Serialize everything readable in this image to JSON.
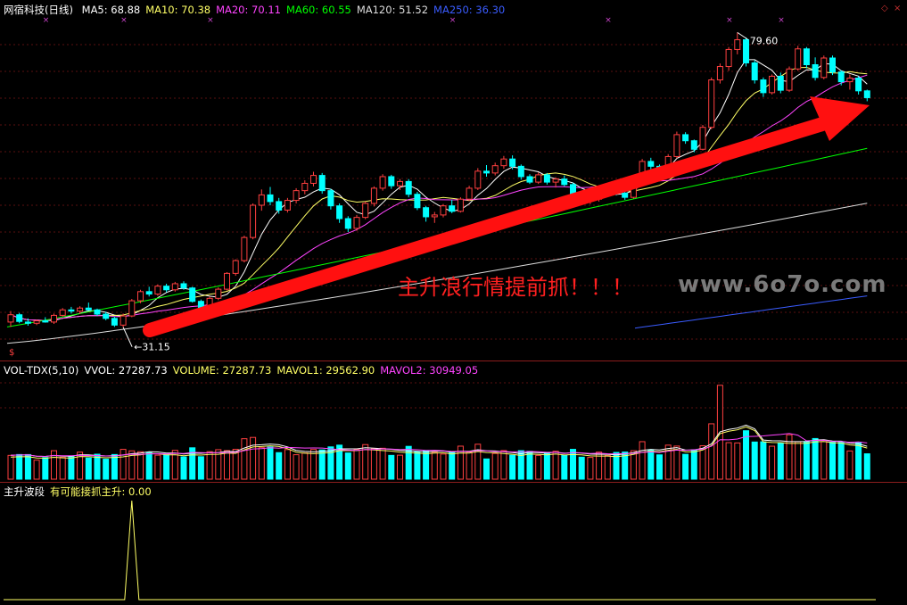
{
  "price_panel": {
    "title": "网宿科技(日线)",
    "ma_labels": [
      {
        "key": "MA5",
        "label": "MA5: 68.88",
        "color": "#ffffff"
      },
      {
        "key": "MA10",
        "label": "MA10: 70.38",
        "color": "#ffff66"
      },
      {
        "key": "MA20",
        "label": "MA20: 70.11",
        "color": "#ff44ff"
      },
      {
        "key": "MA60",
        "label": "MA60: 60.55",
        "color": "#00ff00"
      },
      {
        "key": "MA120",
        "label": "MA120: 51.52",
        "color": "#dddddd"
      },
      {
        "key": "MA250",
        "label": "MA250: 36.30",
        "color": "#3a5cff"
      }
    ],
    "high_label": "79.60",
    "low_label": "31.15",
    "annotation": "主升浪行情提前抓！！！",
    "watermark": "www.6o7o.com",
    "dollar_mark": "$"
  },
  "volume_panel": {
    "labels": [
      {
        "text": "VOL-TDX(5,10)",
        "color": "#ffffff"
      },
      {
        "text": "VVOL: 27287.73",
        "color": "#ffffff"
      },
      {
        "text": "VOLUME: 27287.73",
        "color": "#ffff66"
      },
      {
        "text": "MAVOL1: 29562.90",
        "color": "#ffff66"
      },
      {
        "text": "MAVOL2: 30949.05",
        "color": "#ff44ff"
      }
    ]
  },
  "indicator_panel": {
    "labels": [
      {
        "text": "主升波段",
        "color": "#ffffff"
      },
      {
        "text": "有可能接抓主升: 0.00",
        "color": "#ffff66"
      }
    ]
  },
  "colors": {
    "up": "#ff4040",
    "down": "#00ffff",
    "arrow": "#ff1010",
    "separator": "#8c1d1d"
  },
  "chart_data": {
    "type": "bar",
    "title": "网宿科技(日线)",
    "candles": [
      [
        32.0,
        33.8,
        31.2,
        33.2
      ],
      [
        33.2,
        33.5,
        31.8,
        32.1
      ],
      [
        32.0,
        32.6,
        31.4,
        31.8
      ],
      [
        31.8,
        32.4,
        31.5,
        32.2
      ],
      [
        32.2,
        32.8,
        31.9,
        32.0
      ],
      [
        32.0,
        33.4,
        31.7,
        33.1
      ],
      [
        33.1,
        34.3,
        32.9,
        34.0
      ],
      [
        34.0,
        34.5,
        33.4,
        33.8
      ],
      [
        33.8,
        34.6,
        33.3,
        34.3
      ],
      [
        34.3,
        35.2,
        33.9,
        34.0
      ],
      [
        34.0,
        34.2,
        33.0,
        33.3
      ],
      [
        33.3,
        33.7,
        32.3,
        32.6
      ],
      [
        32.6,
        32.9,
        31.2,
        31.5
      ],
      [
        31.5,
        33.4,
        31.15,
        33.0
      ],
      [
        33.0,
        35.8,
        32.8,
        35.5
      ],
      [
        35.5,
        37.3,
        35.1,
        37.0
      ],
      [
        37.0,
        37.8,
        36.2,
        36.6
      ],
      [
        36.6,
        38.2,
        36.3,
        37.9
      ],
      [
        37.9,
        38.3,
        36.9,
        37.3
      ],
      [
        37.3,
        38.6,
        37.0,
        38.3
      ],
      [
        38.3,
        38.7,
        37.3,
        37.6
      ],
      [
        37.6,
        37.8,
        35.2,
        35.4
      ],
      [
        35.4,
        35.7,
        33.8,
        34.1
      ],
      [
        34.1,
        36.2,
        33.9,
        35.9
      ],
      [
        35.9,
        37.7,
        35.6,
        37.4
      ],
      [
        37.4,
        40.2,
        37.2,
        40.0
      ],
      [
        40.0,
        42.3,
        39.6,
        42.1
      ],
      [
        42.1,
        46.2,
        41.8,
        45.9
      ],
      [
        45.9,
        51.5,
        45.6,
        51.2
      ],
      [
        51.2,
        53.8,
        50.3,
        52.9
      ],
      [
        52.9,
        54.2,
        51.2,
        51.8
      ],
      [
        51.8,
        52.4,
        49.8,
        50.4
      ],
      [
        50.4,
        52.4,
        50.0,
        52.0
      ],
      [
        52.0,
        54.0,
        51.5,
        53.6
      ],
      [
        53.6,
        55.3,
        53.0,
        54.8
      ],
      [
        54.8,
        56.7,
        54.3,
        56.1
      ],
      [
        56.1,
        56.5,
        53.1,
        53.6
      ],
      [
        53.6,
        53.9,
        50.5,
        51.1
      ],
      [
        51.1,
        51.5,
        48.3,
        49.0
      ],
      [
        49.0,
        49.4,
        46.8,
        47.4
      ],
      [
        47.4,
        49.6,
        47.0,
        49.2
      ],
      [
        49.2,
        51.8,
        48.9,
        51.5
      ],
      [
        51.5,
        54.3,
        51.0,
        54.0
      ],
      [
        54.0,
        56.3,
        53.6,
        55.9
      ],
      [
        55.9,
        56.2,
        53.9,
        54.4
      ],
      [
        54.4,
        55.5,
        53.7,
        55.1
      ],
      [
        55.1,
        55.5,
        52.5,
        53.0
      ],
      [
        53.0,
        53.4,
        50.4,
        50.8
      ],
      [
        50.8,
        51.1,
        48.5,
        49.3
      ],
      [
        49.3,
        50.1,
        48.3,
        49.6
      ],
      [
        49.6,
        51.4,
        49.2,
        51.1
      ],
      [
        51.1,
        52.1,
        49.9,
        50.2
      ],
      [
        50.2,
        52.5,
        50.0,
        52.2
      ],
      [
        52.2,
        54.4,
        51.9,
        54.0
      ],
      [
        54.0,
        57.3,
        53.7,
        56.8
      ],
      [
        56.8,
        57.8,
        55.9,
        56.5
      ],
      [
        56.5,
        58.2,
        56.1,
        57.7
      ],
      [
        57.7,
        59.3,
        57.2,
        58.8
      ],
      [
        58.8,
        59.4,
        57.1,
        57.6
      ],
      [
        57.6,
        57.9,
        55.4,
        55.9
      ],
      [
        55.9,
        56.3,
        54.7,
        55.0
      ],
      [
        55.0,
        56.6,
        54.7,
        56.2
      ],
      [
        56.2,
        56.5,
        54.6,
        55.0
      ],
      [
        55.0,
        55.8,
        54.1,
        55.5
      ],
      [
        55.5,
        56.1,
        54.3,
        54.6
      ],
      [
        54.6,
        54.9,
        52.4,
        53.0
      ],
      [
        53.0,
        53.4,
        51.5,
        51.9
      ],
      [
        51.9,
        52.6,
        51.4,
        52.2
      ],
      [
        52.2,
        53.4,
        51.8,
        53.1
      ],
      [
        53.1,
        54.8,
        52.8,
        54.5
      ],
      [
        54.5,
        54.9,
        52.8,
        53.2
      ],
      [
        53.2,
        53.6,
        52.1,
        52.5
      ],
      [
        52.5,
        55.2,
        52.3,
        54.8
      ],
      [
        54.8,
        58.8,
        54.5,
        58.4
      ],
      [
        58.4,
        59.0,
        57.1,
        57.6
      ],
      [
        57.6,
        57.9,
        56.0,
        56.5
      ],
      [
        56.5,
        59.6,
        56.3,
        59.2
      ],
      [
        59.2,
        63.3,
        58.9,
        62.8
      ],
      [
        62.8,
        63.2,
        61.3,
        61.8
      ],
      [
        61.8,
        62.0,
        59.9,
        60.4
      ],
      [
        60.4,
        64.4,
        60.2,
        64.0
      ],
      [
        64.0,
        72.2,
        63.7,
        71.8
      ],
      [
        71.8,
        74.5,
        71.2,
        74.0
      ],
      [
        74.0,
        77.2,
        73.3,
        76.8
      ],
      [
        76.8,
        79.6,
        76.0,
        78.4
      ],
      [
        78.4,
        78.8,
        74.0,
        74.6
      ],
      [
        74.6,
        75.0,
        71.2,
        71.8
      ],
      [
        71.8,
        72.2,
        69.0,
        69.7
      ],
      [
        69.7,
        72.7,
        69.4,
        72.4
      ],
      [
        72.4,
        73.0,
        69.6,
        70.1
      ],
      [
        70.1,
        74.0,
        69.8,
        73.6
      ],
      [
        73.6,
        77.4,
        73.3,
        76.9
      ],
      [
        76.9,
        77.2,
        73.7,
        74.3
      ],
      [
        74.3,
        75.5,
        71.7,
        72.2
      ],
      [
        72.2,
        75.8,
        71.9,
        75.4
      ],
      [
        75.4,
        75.8,
        72.6,
        73.1
      ],
      [
        73.1,
        73.4,
        70.9,
        71.5
      ],
      [
        71.5,
        72.7,
        70.2,
        72.1
      ],
      [
        72.1,
        72.4,
        69.4,
        70.0
      ],
      [
        70.0,
        70.2,
        68.3,
        68.88
      ]
    ],
    "volume": [],
    "indicator_spike_index": 14,
    "ylim": [
      27,
      82
    ]
  }
}
